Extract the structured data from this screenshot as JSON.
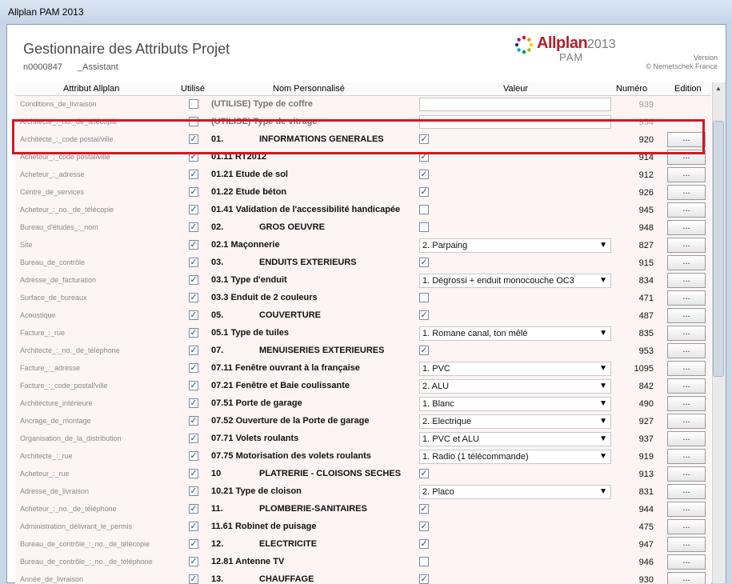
{
  "window_title": "Allplan PAM 2013",
  "header": {
    "title": "Gestionnaire des Attributs Projet",
    "project_code": "n0000847",
    "assistant": "_Assistant",
    "logo_brand": "Allplan",
    "logo_year": "2013",
    "logo_sub": "PAM",
    "version_label": "Version",
    "copyright": "© Nemetschek France"
  },
  "columns": {
    "attr": "Attribut Allplan",
    "used": "Utilisé",
    "name": "Nom Personnalisé",
    "value": "Valeur",
    "number": "Numéro",
    "edit": "Edition"
  },
  "edit_button_label": "...",
  "rows": [
    {
      "attr": "Conditions_de_livraison",
      "used": false,
      "name": "(UTILISE) Type de coffre",
      "value_type": "text",
      "value": "",
      "num": "939",
      "disabled": true
    },
    {
      "attr": "Architecte_:_no._de_télécopie",
      "used": false,
      "name": "(UTILISE) Type de vitrage",
      "value_type": "text",
      "value": "",
      "num": "954",
      "disabled": true
    },
    {
      "attr": "Architecte_:_code postal/ville",
      "used": true,
      "name": "01.",
      "sub": "INFORMATIONS GENERALES",
      "value_type": "check",
      "checked": true,
      "num": "920"
    },
    {
      "attr": "Acheteur_:_code postal/ville",
      "used": true,
      "name": "01.11 RT2012",
      "value_type": "check",
      "checked": true,
      "num": "914"
    },
    {
      "attr": "Acheteur_:_adresse",
      "used": true,
      "name": "01.21 Etude de sol",
      "value_type": "check",
      "checked": true,
      "num": "912"
    },
    {
      "attr": "Centre_de_services",
      "used": true,
      "name": "01.22 Etude béton",
      "value_type": "check",
      "checked": true,
      "num": "926"
    },
    {
      "attr": "Acheteur_:_no._de_télécopie",
      "used": true,
      "name": "01.41 Validation de l'accessibilité handicapée",
      "value_type": "check",
      "checked": false,
      "num": "945"
    },
    {
      "attr": "Bureau_d'études_:_nom",
      "used": true,
      "name": "02.",
      "sub": "GROS OEUVRE",
      "value_type": "check",
      "checked": false,
      "num": "948"
    },
    {
      "attr": "Site",
      "used": true,
      "name": "02.1 Maçonnerie",
      "value_type": "select",
      "value": "2. Parpaing",
      "num": "827"
    },
    {
      "attr": "Bureau_de_contrôle",
      "used": true,
      "name": "03.",
      "sub": "ENDUITS EXTERIEURS",
      "value_type": "check",
      "checked": true,
      "num": "915"
    },
    {
      "attr": "Adresse_de_facturation",
      "used": true,
      "name": "03.1 Type d'enduit",
      "value_type": "select",
      "value": "1. Dégrossi + enduit monocouche OC3",
      "num": "834"
    },
    {
      "attr": "Surface_de_bureaux",
      "used": true,
      "name": "03.3 Enduit de 2 couleurs",
      "value_type": "check",
      "checked": false,
      "num": "471"
    },
    {
      "attr": "Acoustique",
      "used": true,
      "name": "05.",
      "sub": "COUVERTURE",
      "value_type": "check",
      "checked": true,
      "num": "487"
    },
    {
      "attr": "Facture_:_rue",
      "used": true,
      "name": "05.1 Type de tuiles",
      "value_type": "select",
      "value": "1. Romane canal, ton mêlé",
      "num": "835"
    },
    {
      "attr": "Architecte_:_no._de_téléphone",
      "used": true,
      "name": "07.",
      "sub": "MENUISERIES EXTERIEURES",
      "value_type": "check",
      "checked": true,
      "num": "953"
    },
    {
      "attr": "Facture_:_adresse",
      "used": true,
      "name": "07.11 Fenêtre ouvrant à la française",
      "value_type": "select",
      "value": "1. PVC",
      "num": "1095"
    },
    {
      "attr": "Facture_:_code_postal/ville",
      "used": true,
      "name": "07.21 Fenêtre et Baie coulissante",
      "value_type": "select",
      "value": "2. ALU",
      "num": "842"
    },
    {
      "attr": "Architecture_intérieure",
      "used": true,
      "name": "07.51 Porte de garage",
      "value_type": "select",
      "value": "1. Blanc",
      "num": "490"
    },
    {
      "attr": "Ancrage_de_montage",
      "used": true,
      "name": "07.52 Ouverture de la Porte de garage",
      "value_type": "select",
      "value": "2. Electrique",
      "num": "927"
    },
    {
      "attr": "Organisation_de_la_distribution",
      "used": true,
      "name": "07.71 Volets roulants",
      "value_type": "select",
      "value": "1. PVC et ALU",
      "num": "937"
    },
    {
      "attr": "Architecte_:_rue",
      "used": true,
      "name": "07.75 Motorisation des volets roulants",
      "value_type": "select",
      "value": "1. Radio (1 télécommande)",
      "num": "919"
    },
    {
      "attr": "Acheteur_:_rue",
      "used": true,
      "name": "10",
      "sub": "PLATRERIE - CLOISONS SECHES",
      "value_type": "check",
      "checked": true,
      "num": "913"
    },
    {
      "attr": "Adresse_de_livraison",
      "used": true,
      "name": "10.21 Type de cloison",
      "value_type": "select",
      "value": "2. Placo",
      "num": "831"
    },
    {
      "attr": "Acheteur_:_no._de_téléphone",
      "used": true,
      "name": "11.",
      "sub": "PLOMBERIE-SANITAIRES",
      "value_type": "check",
      "checked": true,
      "num": "944"
    },
    {
      "attr": "Administration_délivrant_le_permis",
      "used": true,
      "name": "11.61 Robinet de puisage",
      "value_type": "check",
      "checked": true,
      "num": "475"
    },
    {
      "attr": "Bureau_de_contrôle_:_no._de_télécopie",
      "used": true,
      "name": "12.",
      "sub": "ELECTRICITE",
      "value_type": "check",
      "checked": true,
      "num": "947"
    },
    {
      "attr": "Bureau_de_contrôle_:_no._de_téléphone",
      "used": true,
      "name": "12.81 Antenne TV",
      "value_type": "check",
      "checked": false,
      "num": "946"
    },
    {
      "attr": "Année_de_livraison",
      "used": true,
      "name": "13.",
      "sub": "CHAUFFAGE",
      "value_type": "check",
      "checked": true,
      "num": "930"
    }
  ]
}
